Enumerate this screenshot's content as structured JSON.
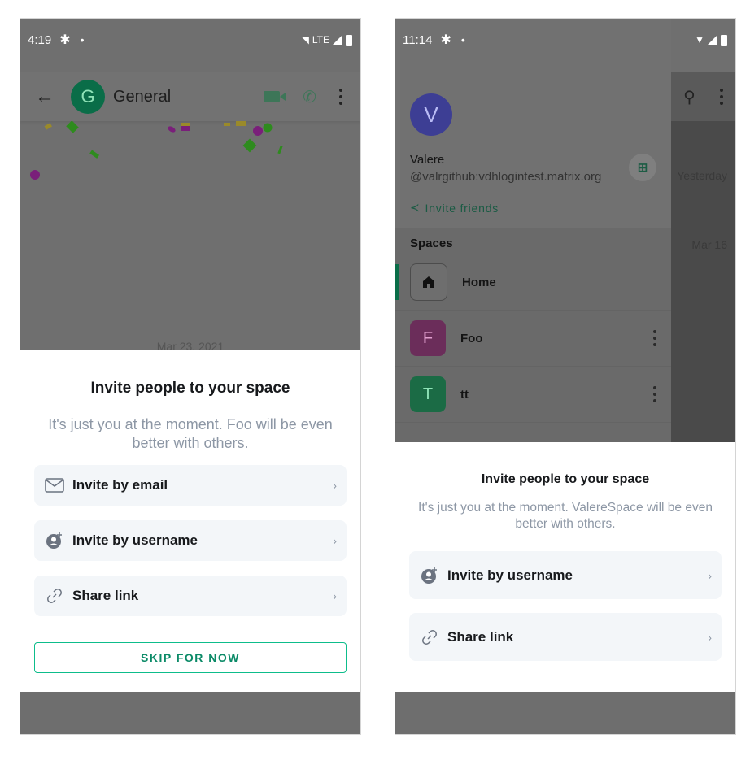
{
  "left": {
    "status": {
      "time": "4:19",
      "network": "LTE"
    },
    "appbar": {
      "room_initial": "G",
      "room_name": "General"
    },
    "date_peek": "Mar 23, 2021",
    "sheet": {
      "title": "Invite people to your space",
      "subtitle": "It's just you at the moment. Foo will be even better with others.",
      "options": [
        {
          "label": "Invite by email",
          "icon": "mail-icon"
        },
        {
          "label": "Invite by username",
          "icon": "add-user-icon"
        },
        {
          "label": "Share link",
          "icon": "link-icon"
        }
      ],
      "skip_label": "SKIP FOR NOW"
    }
  },
  "right": {
    "status": {
      "time": "11:14"
    },
    "drawer": {
      "avatar_initial": "V",
      "user_name": "Valere",
      "user_id": "@valrgithub:vdhlogintest.matrix.org",
      "invite_friends": "Invite friends",
      "spaces_header": "Spaces",
      "spaces": [
        {
          "initial": "",
          "name": "Home",
          "color": "#6e6e6e"
        },
        {
          "initial": "F",
          "name": "Foo",
          "color": "#6b2d5a"
        },
        {
          "initial": "T",
          "name": "tt",
          "color": "#1b6b45"
        }
      ]
    },
    "behind": {
      "yesterday": "Yesterday",
      "mar16": "Mar 16"
    },
    "sheet": {
      "title": "Invite people to your space",
      "subtitle": "It's just you at the moment. ValereSpace will be even better with others.",
      "options": [
        {
          "label": "Invite by username",
          "icon": "add-user-icon"
        },
        {
          "label": "Share link",
          "icon": "link-icon"
        }
      ]
    }
  }
}
